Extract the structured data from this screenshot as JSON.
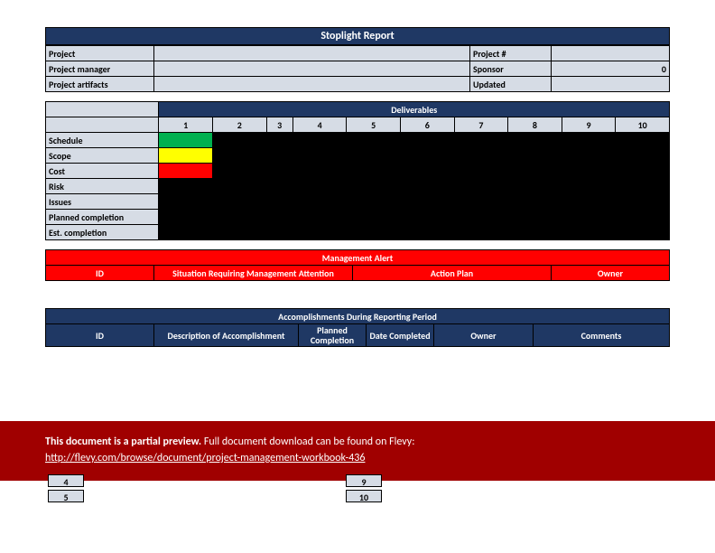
{
  "title": "Stoplight Report",
  "info": {
    "project_label": "Project",
    "project_num_label": "Project #",
    "pm_label": "Project manager",
    "sponsor_label": "Sponsor",
    "sponsor_value": "0",
    "artifacts_label": "Project artifacts",
    "updated_label": "Updated"
  },
  "deliverables": {
    "header": "Deliverables",
    "cols": [
      "1",
      "2",
      "3",
      "4",
      "5",
      "6",
      "7",
      "8",
      "9",
      "10"
    ],
    "rows": [
      "Schedule",
      "Scope",
      "Cost",
      "Risk",
      "Issues",
      "Planned completion",
      "Est. completion"
    ]
  },
  "alert": {
    "header": "Management Alert",
    "cols": [
      "ID",
      "Situation Requiring Management Attention",
      "Action Plan",
      "Owner"
    ]
  },
  "accomp": {
    "header": "Accomplishments During Reporting Period",
    "cols": [
      "ID",
      "Description of Accomplishment",
      "Planned Completion",
      "Date Completed",
      "Owner",
      "Comments"
    ]
  },
  "preview": {
    "bold": "This document is a partial preview.",
    "tail": " Full document download can be found on Flevy:",
    "link": "http://flevy.com/browse/document/project-management-workbook-436"
  },
  "bottom": {
    "a1": "4",
    "a2": "5",
    "b1": "9",
    "b2": "10"
  }
}
